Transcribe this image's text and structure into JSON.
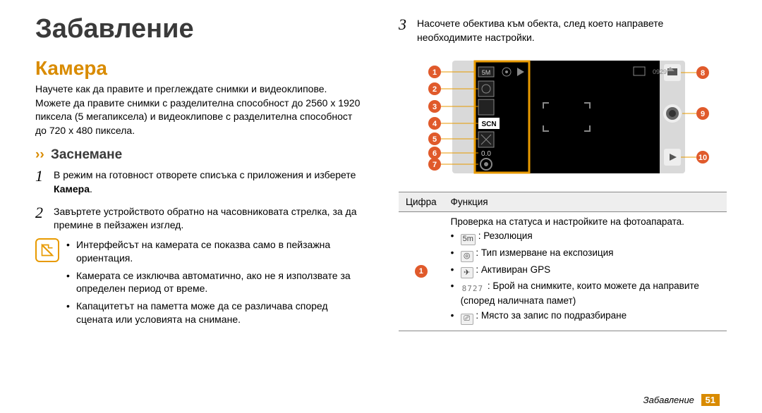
{
  "page_title": "Забавление",
  "section_heading": "Камера",
  "intro_text": "Научете как да правите и преглеждате снимки и видеоклипове. Можете да правите снимки с разделителна способност до 2560 x 1920 пиксела (5 мегапиксела) и видеоклипове с разделителна способност до 720 x 480 пиксела.",
  "sub_chevron": "››",
  "sub_heading": "Заснемане",
  "steps": [
    {
      "num": "1",
      "before_bold": "В режим на готовност отворете списъка с приложения и изберете ",
      "bold": "Камера",
      "after_bold": "."
    },
    {
      "num": "2",
      "text": "Завъртете устройството обратно на часовниковата стрелка, за да премине в пейзажен изглед."
    }
  ],
  "notes": [
    "Интерфейсът на камерата се показва само в пейзажна ориентация.",
    "Камерата се изключва автоматично, ако не я използвате за определен период от време.",
    "Капацитетът на паметта може да се различава според сцената или условията на снимане."
  ],
  "step3": {
    "num": "3",
    "text": "Насочете обектива към обекта, след което направете необходимите настройки."
  },
  "callouts_left": [
    "1",
    "2",
    "3",
    "4",
    "5",
    "6",
    "7"
  ],
  "callouts_right": [
    "8",
    "9",
    "10"
  ],
  "diagram_texts": {
    "scn": "SCN",
    "exposure_val": "0.0",
    "counter": "0929"
  },
  "table": {
    "head_number": "Цифра",
    "head_function": "Функция",
    "row1_num": "1",
    "row1_intro": "Проверка на статуса и настройките на фотоапарата.",
    "row1_items": [
      {
        "icon_label": "5m",
        "text": " : Резолюция"
      },
      {
        "icon_label": "◎",
        "text": " : Тип измерване на експозиция"
      },
      {
        "icon_label": "✈",
        "text": " : Активиран GPS"
      },
      {
        "icon_label": "8727",
        "is_num": true,
        "text": " : Брой на снимките, които можете да направите (според наличната памет)"
      },
      {
        "icon_label": "⎚",
        "text": " : Място за запис по подразбиране"
      }
    ]
  },
  "footer_label": "Забавление",
  "page_number": "51"
}
